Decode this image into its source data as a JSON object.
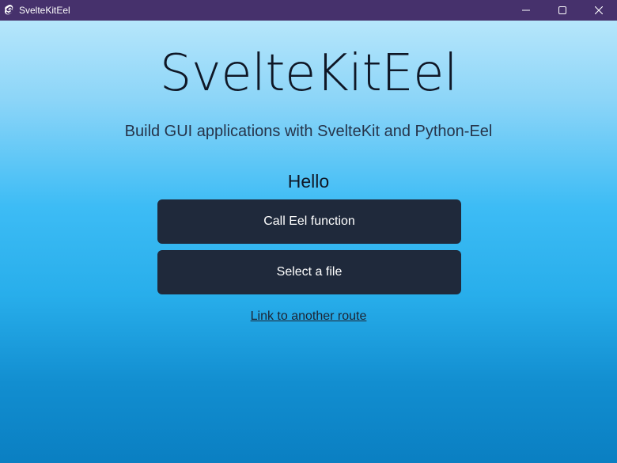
{
  "window": {
    "title": "SvelteKitEel",
    "icon": "svelte-logo-icon",
    "controls": [
      "minimize-icon",
      "maximize-icon",
      "close-icon"
    ],
    "titlebar_color": "#46316c"
  },
  "main": {
    "title": "SvelteKitEel",
    "subtitle": "Build GUI applications with SvelteKit and Python-Eel",
    "greeting": "Hello",
    "buttons": {
      "call_eel": "Call Eel function",
      "select_file": "Select a file"
    },
    "link": "Link to another route",
    "button_color": "#1f293b"
  }
}
